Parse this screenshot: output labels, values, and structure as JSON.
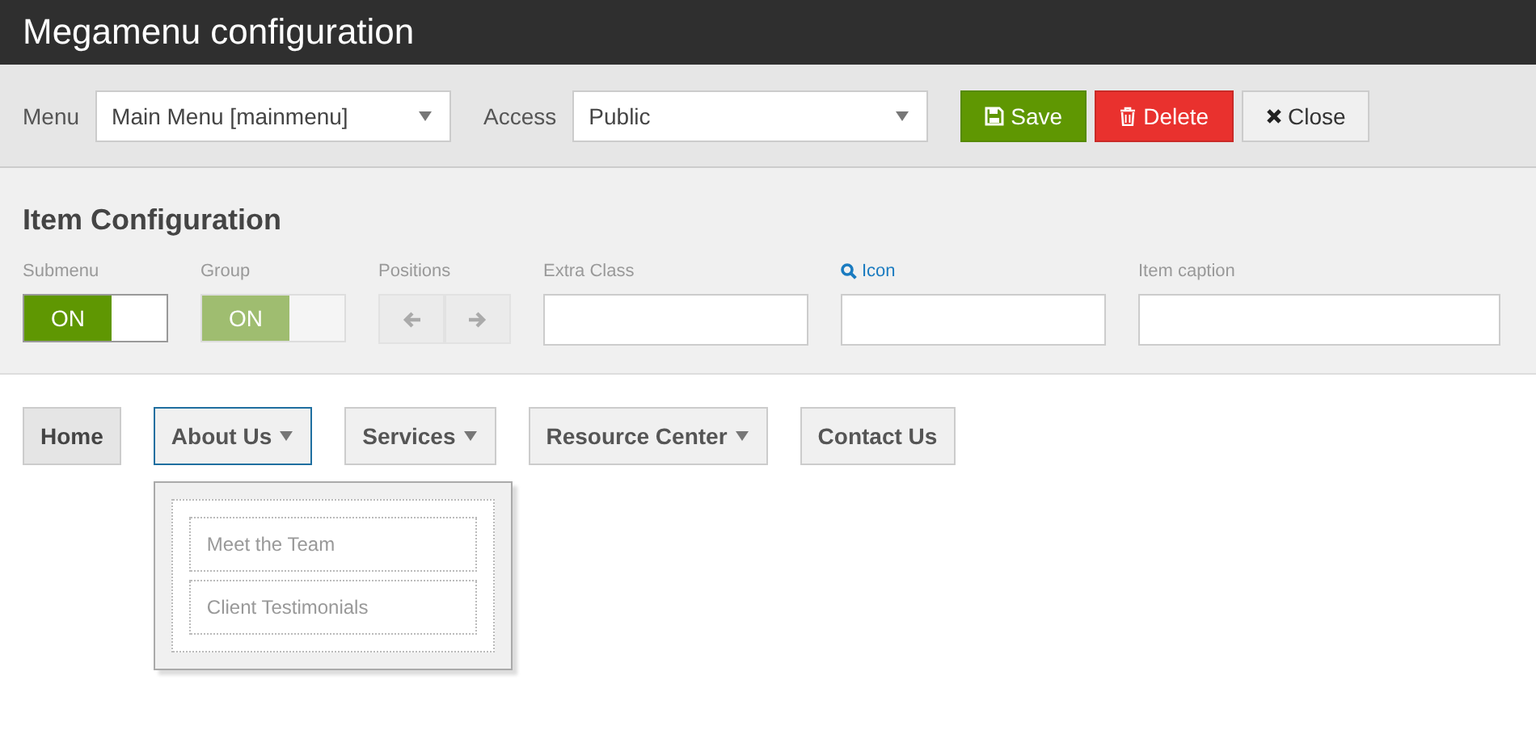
{
  "window": {
    "title": "Megamenu configuration"
  },
  "toolbar": {
    "menu_label": "Menu",
    "menu_value": "Main Menu [mainmenu]",
    "access_label": "Access",
    "access_value": "Public",
    "buttons": [
      {
        "label": "Save",
        "kind": "save"
      },
      {
        "label": "Delete",
        "kind": "delete"
      },
      {
        "label": "Close",
        "kind": "close"
      }
    ]
  },
  "item_configuration": {
    "heading": "Item Configuration",
    "toggles": [
      {
        "label": "Submenu",
        "state": "ON",
        "on": true,
        "disabled": false
      },
      {
        "label": "Group",
        "state": "ON",
        "on": true,
        "disabled": true
      }
    ],
    "positions": {
      "label": "Positions",
      "disabled": true
    },
    "fields": [
      {
        "label": "Extra Class",
        "kind": "plain"
      },
      {
        "label": "Icon",
        "kind": "icon-link"
      },
      {
        "label": "Item caption",
        "kind": "plain",
        "wide": true
      }
    ]
  },
  "menu": [
    {
      "label": "Home",
      "caret": false,
      "selected": false,
      "current": true
    },
    {
      "label": "About Us",
      "caret": true,
      "selected": true,
      "current": false,
      "children": [
        {
          "label": "Meet the Team"
        },
        {
          "label": "Client Testimonials"
        }
      ]
    },
    {
      "label": "Services",
      "caret": true,
      "selected": false,
      "current": false
    },
    {
      "label": "Resource Center",
      "caret": true,
      "selected": false,
      "current": false
    },
    {
      "label": "Contact Us",
      "caret": false,
      "selected": false,
      "current": false
    }
  ]
}
